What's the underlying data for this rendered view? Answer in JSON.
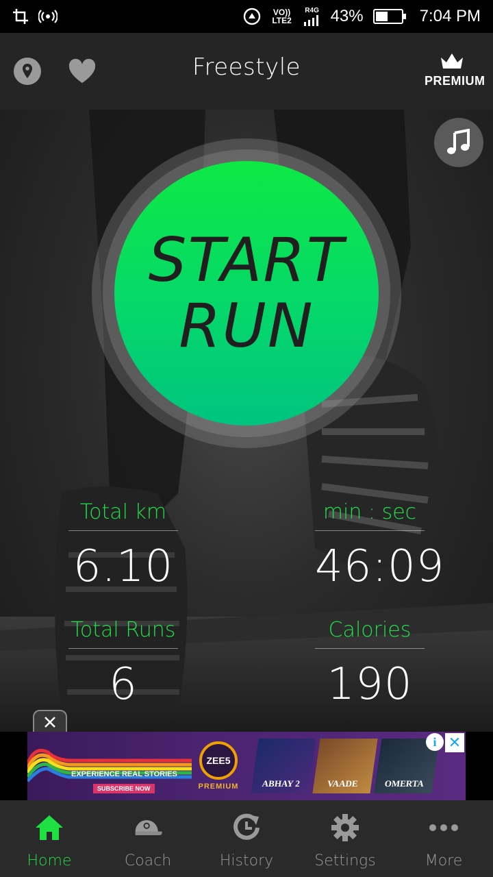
{
  "status_bar": {
    "signal_label": "VO)) LTE2",
    "network_label": "R4G",
    "battery_percent": "43%",
    "battery_level": 0.43,
    "time": "7:04 PM"
  },
  "app_bar": {
    "title": "Freestyle",
    "premium_label": "PREMIUM"
  },
  "start_button": {
    "line1": "START",
    "line2": "RUN"
  },
  "stats": {
    "total_km": {
      "label": "Total km",
      "value": "6.10"
    },
    "duration": {
      "label": "min : sec",
      "value": "46:09"
    },
    "total_runs": {
      "label": "Total Runs",
      "value": "6"
    },
    "calories": {
      "label": "Calories",
      "value": "190"
    }
  },
  "ad": {
    "tagline": "EXPERIENCE REAL STORIES",
    "cta": "SUBSCRIBE NOW",
    "brand": "ZEE5",
    "brand_sub": "PREMIUM",
    "posters": [
      "ABHAY 2",
      "VAADE",
      "OMERTA"
    ],
    "info_symbol": "i",
    "close_symbol": "✕"
  },
  "bottom_nav": {
    "items": [
      {
        "label": "Home",
        "icon": "home-icon",
        "active": true
      },
      {
        "label": "Coach",
        "icon": "coach-cap-icon",
        "active": false
      },
      {
        "label": "History",
        "icon": "history-icon",
        "active": false
      },
      {
        "label": "Settings",
        "icon": "gear-icon",
        "active": false
      },
      {
        "label": "More",
        "icon": "more-dots-icon",
        "active": false
      }
    ]
  },
  "colors": {
    "accent_green": "#1fe043",
    "start_button_top": "#0ee844",
    "start_button_bottom": "#00c47f",
    "app_bar_bg": "#252525",
    "nav_bg": "#2a2a2a"
  }
}
